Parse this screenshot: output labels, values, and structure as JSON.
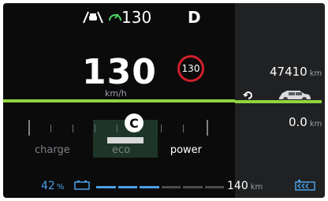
{
  "header": {
    "set_speed": "130",
    "gear": "D",
    "icons": [
      "lane-assist-icon",
      "cruise-control-icon"
    ]
  },
  "speed": {
    "value": "130",
    "unit": "km/h",
    "limit": "130"
  },
  "marker": {
    "letter": "C"
  },
  "power_gauge": {
    "labels": {
      "charge": "charge",
      "eco": "eco",
      "power": "power"
    },
    "level_fraction": 0.62
  },
  "odometer": {
    "value": "47410",
    "unit": "km"
  },
  "trip": {
    "value": "0.0",
    "unit": "km"
  },
  "battery": {
    "percent": "42",
    "percent_unit": "%",
    "fill_fraction": 0.42,
    "range_value": "140",
    "range_unit": "km"
  },
  "colors": {
    "accent_green": "#8fd43f",
    "accent_blue": "#4a9fe6",
    "limit_red": "#d0202a",
    "background": "#0b0b0c"
  }
}
